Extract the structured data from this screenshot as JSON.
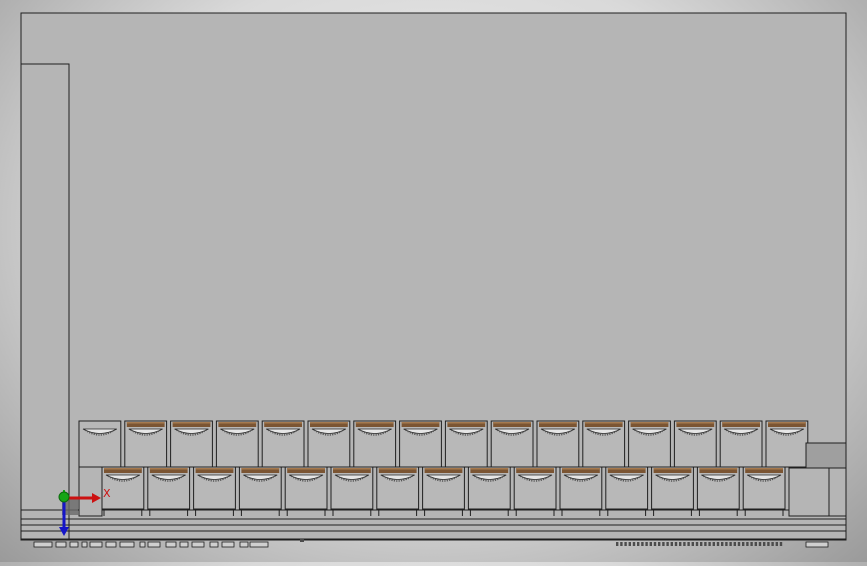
{
  "viewport": {
    "label": "",
    "colors": {
      "background": "#d9d9d9",
      "part_face": "#b5b5b5",
      "edge": "#1f1f1f",
      "wood_top": "#7b5533",
      "wood_highlight": "#a67a4f",
      "hardware": "#4c4c4c"
    },
    "model": {
      "upper_row_count": 16,
      "lower_row_count": 15
    }
  },
  "triad": {
    "x_label": "X",
    "x_color": "#cc1111",
    "y_color": "#16a616",
    "z_color": "#1515c8",
    "origin_icon": "origin-sphere-icon"
  }
}
